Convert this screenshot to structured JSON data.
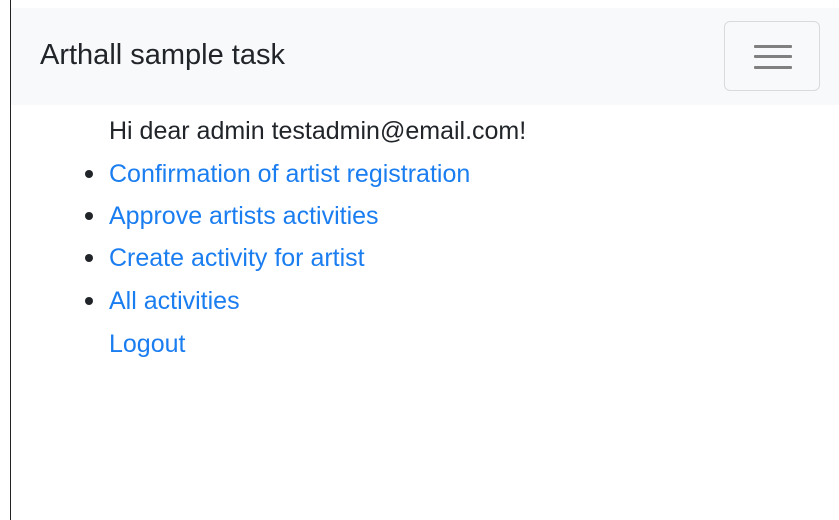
{
  "navbar": {
    "brand": "Arthall sample task",
    "toggler_icon": "hamburger-menu-icon"
  },
  "main": {
    "greeting": "Hi dear admin testadmin@email.com!",
    "menu_items": [
      {
        "label": "Confirmation of artist registration"
      },
      {
        "label": "Approve artists activities"
      },
      {
        "label": "Create activity for artist"
      },
      {
        "label": "All activities"
      }
    ],
    "logout_label": "Logout"
  },
  "colors": {
    "navbar_bg": "#f8f9fa",
    "link": "#1a7df0",
    "text": "#212529"
  }
}
